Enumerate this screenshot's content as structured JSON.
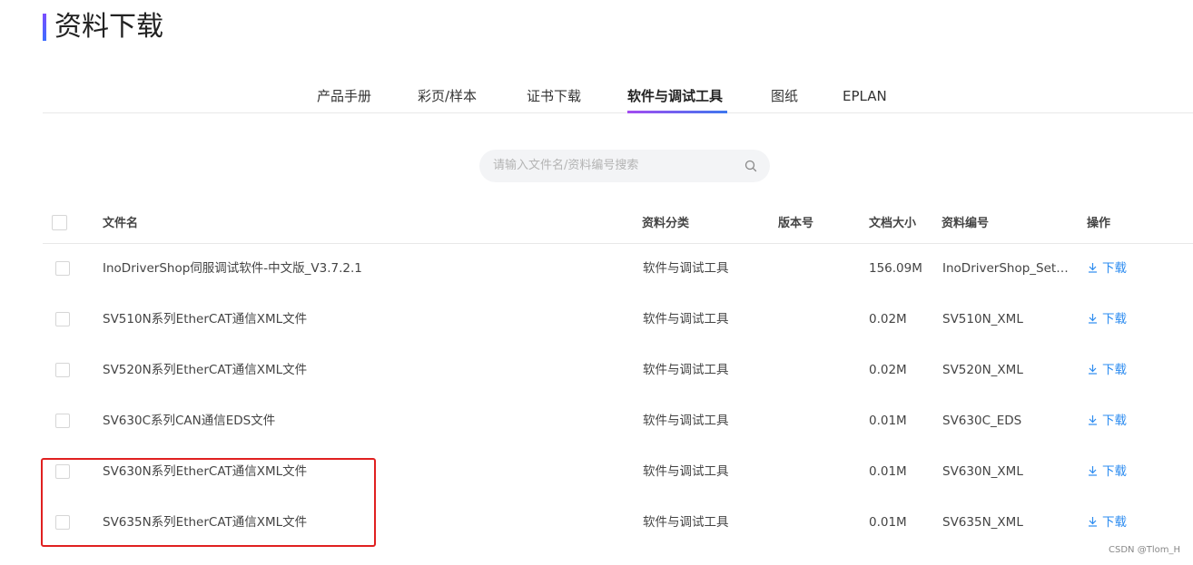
{
  "page_title": "资料下载",
  "tabs": [
    {
      "label": "产品手册"
    },
    {
      "label": "彩页/样本"
    },
    {
      "label": "证书下载"
    },
    {
      "label": "软件与调试工具",
      "active": true
    },
    {
      "label": "图纸"
    },
    {
      "label": "EPLAN"
    }
  ],
  "search": {
    "placeholder": "请输入文件名/资料编号搜索",
    "icon": "search-icon"
  },
  "table": {
    "headers": {
      "name": "文件名",
      "category": "资料分类",
      "version": "版本号",
      "size": "文档大小",
      "code": "资料编号",
      "action": "操作"
    },
    "rows": [
      {
        "name": "InoDriverShop伺服调试软件-中文版_V3.7.2.1",
        "category": "软件与调试工具",
        "version": "",
        "size": "156.09M",
        "code": "InoDriverShop_Set…",
        "action": "下载"
      },
      {
        "name": "SV510N系列EtherCAT通信XML文件",
        "category": "软件与调试工具",
        "version": "",
        "size": "0.02M",
        "code": "SV510N_XML",
        "action": "下载"
      },
      {
        "name": "SV520N系列EtherCAT通信XML文件",
        "category": "软件与调试工具",
        "version": "",
        "size": "0.02M",
        "code": "SV520N_XML",
        "action": "下载"
      },
      {
        "name": "SV630C系列CAN通信EDS文件",
        "category": "软件与调试工具",
        "version": "",
        "size": "0.01M",
        "code": "SV630C_EDS",
        "action": "下载"
      },
      {
        "name": "SV630N系列EtherCAT通信XML文件",
        "category": "软件与调试工具",
        "version": "",
        "size": "0.01M",
        "code": "SV630N_XML",
        "action": "下载"
      },
      {
        "name": "SV635N系列EtherCAT通信XML文件",
        "category": "软件与调试工具",
        "version": "",
        "size": "0.01M",
        "code": "SV635N_XML",
        "action": "下载"
      }
    ]
  },
  "colors": {
    "accent": "#2d8cf0",
    "highlight": "#e02020"
  },
  "watermark": "CSDN @Tlom_H"
}
